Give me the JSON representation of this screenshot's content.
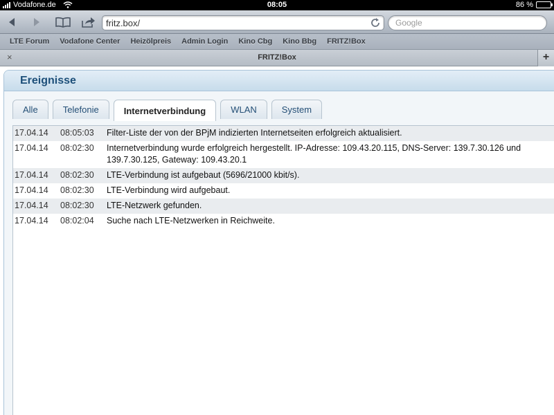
{
  "statusbar": {
    "carrier": "Vodafone.de",
    "time": "08:05",
    "battery": "86 %",
    "battery_level": 0.86
  },
  "browser": {
    "url": "fritz.box/",
    "search_placeholder": "Google",
    "icons": [
      "back-icon",
      "forward-icon",
      "bookmarks-icon",
      "share-icon",
      "reload-icon"
    ],
    "bookmarks": [
      "LTE Forum",
      "Vodafone Center",
      "Heizölpreis",
      "Admin Login",
      "Kino Cbg",
      "Kino Bbg",
      "FRITZ!Box"
    ],
    "tab": {
      "close": "×",
      "title": "FRITZ!Box",
      "new": "+"
    }
  },
  "page": {
    "title": "Ereignisse",
    "tabs": [
      {
        "label": "Alle",
        "active": false
      },
      {
        "label": "Telefonie",
        "active": false
      },
      {
        "label": "Internetverbindung",
        "active": true
      },
      {
        "label": "WLAN",
        "active": false
      },
      {
        "label": "System",
        "active": false
      }
    ],
    "events": [
      {
        "date": "17.04.14",
        "time": "08:05:03",
        "message": "Filter-Liste der von der BPjM indizierten Internetseiten erfolgreich aktualisiert."
      },
      {
        "date": "17.04.14",
        "time": "08:02:30",
        "message": "Internetverbindung wurde erfolgreich hergestellt. IP-Adresse: 109.43.20.115, DNS-Server: 139.7.30.126 und 139.7.30.125, Gateway: 109.43.20.1"
      },
      {
        "date": "17.04.14",
        "time": "08:02:30",
        "message": "LTE-Verbindung ist aufgebaut (5696/21000 kbit/s)."
      },
      {
        "date": "17.04.14",
        "time": "08:02:30",
        "message": "LTE-Verbindung wird aufgebaut."
      },
      {
        "date": "17.04.14",
        "time": "08:02:30",
        "message": "LTE-Netzwerk gefunden."
      },
      {
        "date": "17.04.14",
        "time": "08:02:04",
        "message": "Suche nach LTE-Netzwerken in Reichweite."
      }
    ]
  }
}
